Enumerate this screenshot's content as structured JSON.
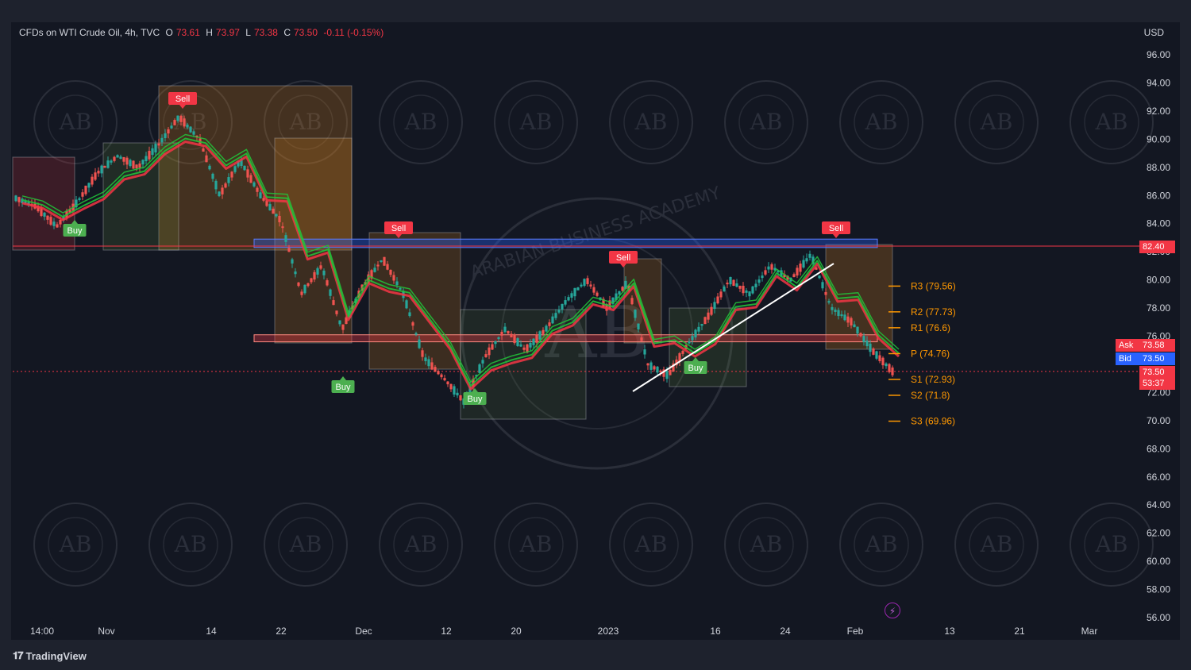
{
  "legend": {
    "symbol": "CFDs on WTI Crude Oil, 4h, TVC",
    "open_label": "O",
    "open": "73.61",
    "high_label": "H",
    "high": "73.97",
    "low_label": "L",
    "low": "73.38",
    "close_label": "C",
    "close": "73.50",
    "change": "-0.11 (-0.15%)"
  },
  "currency": "USD",
  "footer": {
    "brand": "TradingView",
    "logo_icon": "tradingview-logo-icon"
  },
  "quote": {
    "ask_label": "Ask",
    "ask": "73.58",
    "bid_label": "Bid",
    "bid": "73.50",
    "last": "73.50",
    "countdown": "53:37",
    "resistance_line": "82.40"
  },
  "colors": {
    "background": "#131722",
    "up": "#26a69a",
    "down": "#ef5350",
    "bull_ribbon": "#22c53a",
    "bear_ribbon": "#f23645",
    "pivot": "#ff9800",
    "ask": "#f23645",
    "bid": "#2962ff"
  },
  "chart_data": {
    "type": "candlestick",
    "y_axis": {
      "ticks": [
        "96.00",
        "94.00",
        "92.00",
        "90.00",
        "88.00",
        "86.00",
        "84.00",
        "82.00",
        "80.00",
        "78.00",
        "76.00",
        "72.00",
        "70.00",
        "68.00",
        "66.00",
        "64.00",
        "62.00",
        "60.00",
        "58.00",
        "56.00"
      ],
      "range": [
        56,
        96
      ]
    },
    "x_axis": {
      "ticks": [
        "14:00",
        "Nov",
        "14",
        "22",
        "Dec",
        "12",
        "20",
        "2023",
        "16",
        "24",
        "Feb",
        "13",
        "21",
        "Mar"
      ]
    },
    "close_path": [
      {
        "t": "14:00",
        "y": 85.8
      },
      {
        "t": "",
        "y": 85.2
      },
      {
        "t": "",
        "y": 83.8
      },
      {
        "t": "",
        "y": 85.5
      },
      {
        "t": "Nov",
        "y": 87.6
      },
      {
        "t": "",
        "y": 88.8
      },
      {
        "t": "",
        "y": 88.0
      },
      {
        "t": "",
        "y": 89.6
      },
      {
        "t": "",
        "y": 91.6
      },
      {
        "t": "",
        "y": 90.0
      },
      {
        "t": "14",
        "y": 86.0
      },
      {
        "t": "",
        "y": 88.5
      },
      {
        "t": "",
        "y": 86.0
      },
      {
        "t": "",
        "y": 84.2
      },
      {
        "t": "22",
        "y": 79.0
      },
      {
        "t": "",
        "y": 81.0
      },
      {
        "t": "",
        "y": 76.5
      },
      {
        "t": "",
        "y": 79.5
      },
      {
        "t": "Dec",
        "y": 81.5
      },
      {
        "t": "",
        "y": 79.0
      },
      {
        "t": "",
        "y": 74.5
      },
      {
        "t": "",
        "y": 73.0
      },
      {
        "t": "12",
        "y": 71.3
      },
      {
        "t": "",
        "y": 74.5
      },
      {
        "t": "",
        "y": 76.5
      },
      {
        "t": "",
        "y": 75.0
      },
      {
        "t": "20",
        "y": 76.5
      },
      {
        "t": "",
        "y": 78.5
      },
      {
        "t": "",
        "y": 80.0
      },
      {
        "t": "",
        "y": 78.0
      },
      {
        "t": "2023",
        "y": 79.8
      },
      {
        "t": "",
        "y": 74.0
      },
      {
        "t": "",
        "y": 73.2
      },
      {
        "t": "",
        "y": 75.5
      },
      {
        "t": "16",
        "y": 77.5
      },
      {
        "t": "",
        "y": 80.0
      },
      {
        "t": "",
        "y": 79.0
      },
      {
        "t": "24",
        "y": 81.0
      },
      {
        "t": "",
        "y": 80.0
      },
      {
        "t": "",
        "y": 81.8
      },
      {
        "t": "",
        "y": 78.0
      },
      {
        "t": "Feb",
        "y": 77.0
      },
      {
        "t": "",
        "y": 75.0
      },
      {
        "t": "",
        "y": 73.5
      }
    ],
    "pivot_levels": [
      {
        "label": "R3 (79.56)",
        "value": 79.56
      },
      {
        "label": "R2 (77.73)",
        "value": 77.73
      },
      {
        "label": "R1 (76.6)",
        "value": 76.6
      },
      {
        "label": "P (74.76)",
        "value": 74.76
      },
      {
        "label": "S1 (72.93)",
        "value": 72.93
      },
      {
        "label": "S2 (71.8)",
        "value": 71.8
      },
      {
        "label": "S3 (69.96)",
        "value": 69.96
      }
    ],
    "signals": [
      {
        "label": "Buy",
        "t": "Nov",
        "price": 84.3,
        "type": "buy"
      },
      {
        "label": "Sell",
        "t": "14",
        "price": 92.2,
        "type": "sell"
      },
      {
        "label": "Sell",
        "t": "Dec",
        "price": 82.8,
        "type": "sell"
      },
      {
        "label": "Buy",
        "t": "Dec",
        "price": 73.2,
        "type": "buy"
      },
      {
        "label": "Buy",
        "t": "20",
        "price": 72.4,
        "type": "buy"
      },
      {
        "label": "Sell",
        "t": "2023",
        "price": 80.8,
        "type": "sell"
      },
      {
        "label": "Buy",
        "t": "16",
        "price": 74.5,
        "type": "buy"
      },
      {
        "label": "Sell",
        "t": "Feb",
        "price": 82.8,
        "type": "sell"
      }
    ],
    "horizontal_lines": [
      {
        "value": 82.4,
        "label": "82.40"
      },
      {
        "value": 73.5,
        "label": "73.50"
      }
    ],
    "zones": [
      {
        "from": 82.3,
        "to": 82.9,
        "label": ""
      },
      {
        "from": 75.6,
        "to": 76.1,
        "label": ""
      }
    ],
    "watermark": {
      "text": "ARABIAN BUSINESS ACADEMY",
      "monogram": "AB"
    }
  }
}
